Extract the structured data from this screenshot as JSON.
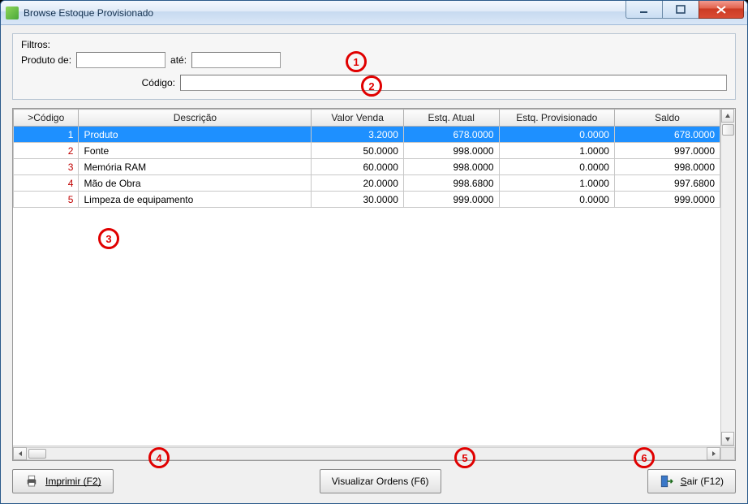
{
  "window": {
    "title": "Browse Estoque Provisionado"
  },
  "filters": {
    "legend": "Filtros:",
    "produto_de_label": "Produto de:",
    "ate_label": "até:",
    "codigo_label": "Código:",
    "produto_de_value": "",
    "produto_ate_value": "",
    "codigo_value": ""
  },
  "grid": {
    "headers": {
      "codigo": ">Código",
      "descricao": "Descrição",
      "valor_venda": "Valor Venda",
      "estq_atual": "Estq. Atual",
      "estq_prov": "Estq. Provisionado",
      "saldo": "Saldo"
    },
    "rows": [
      {
        "codigo": "1",
        "descricao": "Produto",
        "valor_venda": "3.2000",
        "estq_atual": "678.0000",
        "estq_prov": "0.0000",
        "saldo": "678.0000",
        "selected": true
      },
      {
        "codigo": "2",
        "descricao": "Fonte",
        "valor_venda": "50.0000",
        "estq_atual": "998.0000",
        "estq_prov": "1.0000",
        "saldo": "997.0000"
      },
      {
        "codigo": "3",
        "descricao": "Memória RAM",
        "valor_venda": "60.0000",
        "estq_atual": "998.0000",
        "estq_prov": "0.0000",
        "saldo": "998.0000"
      },
      {
        "codigo": "4",
        "descricao": "Mão de Obra",
        "valor_venda": "20.0000",
        "estq_atual": "998.6800",
        "estq_prov": "1.0000",
        "saldo": "997.6800"
      },
      {
        "codigo": "5",
        "descricao": "Limpeza de equipamento",
        "valor_venda": "30.0000",
        "estq_atual": "999.0000",
        "estq_prov": "0.0000",
        "saldo": "999.0000"
      }
    ]
  },
  "buttons": {
    "imprimir": "Imprimir (F2)",
    "visualizar": "Visualizar Ordens (F6)",
    "sair": "Sair (F12)"
  },
  "annotations": {
    "a1": "1",
    "a2": "2",
    "a3": "3",
    "a4": "4",
    "a5": "5",
    "a6": "6"
  }
}
